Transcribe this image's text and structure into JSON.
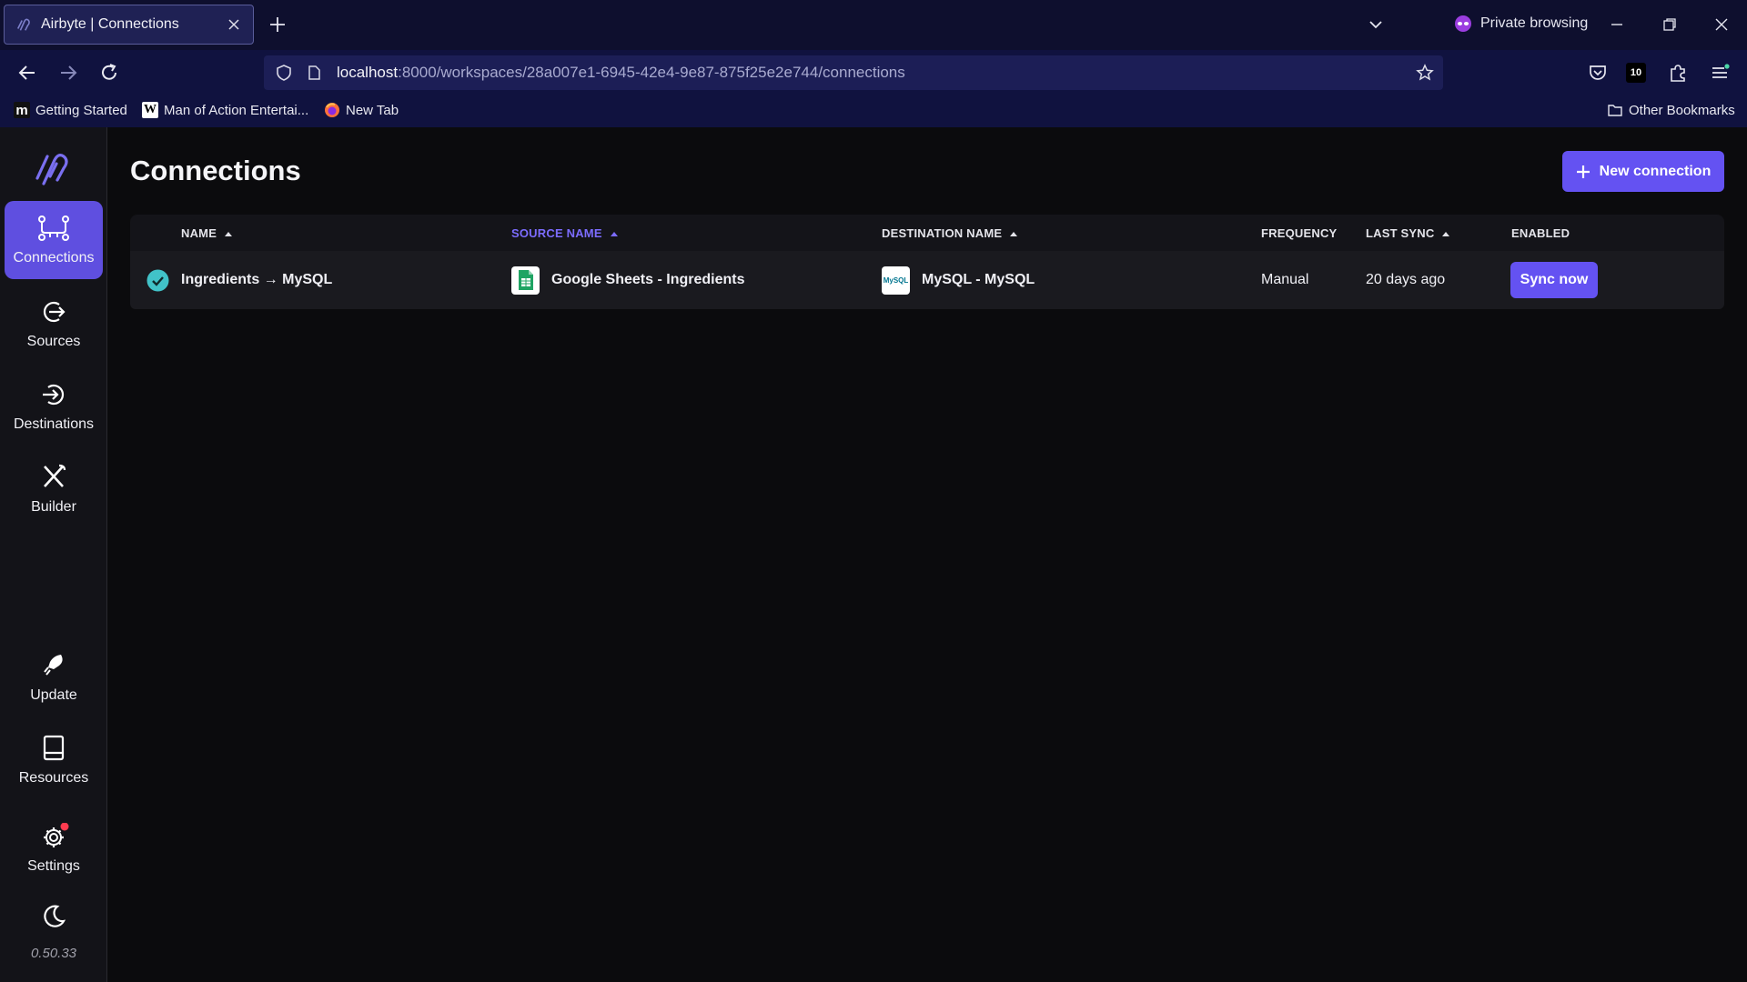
{
  "browser": {
    "tab_title": "Airbyte | Connections",
    "private_label": "Private browsing",
    "url_host": "localhost",
    "url_path": ":8000/workspaces/28a007e1-6945-42e4-9e87-875f25e2e744/connections",
    "extension_badge": "10",
    "bookmarks": [
      {
        "label": "Getting Started",
        "icon": "m-logo-icon"
      },
      {
        "label": "Man of Action Entertai...",
        "icon": "wikipedia-icon"
      },
      {
        "label": "New Tab",
        "icon": "firefox-icon"
      }
    ],
    "other_bookmarks": "Other Bookmarks"
  },
  "sidebar": {
    "items": [
      {
        "label": "Connections",
        "icon": "connections-icon",
        "active": true
      },
      {
        "label": "Sources",
        "icon": "sources-icon"
      },
      {
        "label": "Destinations",
        "icon": "destinations-icon"
      },
      {
        "label": "Builder",
        "icon": "builder-icon"
      }
    ],
    "bottom_items": [
      {
        "label": "Update",
        "icon": "rocket-icon"
      },
      {
        "label": "Resources",
        "icon": "book-icon"
      },
      {
        "label": "Settings",
        "icon": "gear-icon"
      }
    ],
    "version": "0.50.33"
  },
  "main": {
    "title": "Connections",
    "new_button": "New connection",
    "columns": {
      "name": "NAME",
      "source": "SOURCE NAME",
      "destination": "DESTINATION NAME",
      "frequency": "FREQUENCY",
      "last_sync": "LAST SYNC",
      "enabled": "ENABLED"
    },
    "rows": [
      {
        "name": "Ingredients → MySQL",
        "source": "Google Sheets - Ingredients",
        "destination": "MySQL - MySQL",
        "destination_logo_text": "MySQL",
        "frequency": "Manual",
        "last_sync": "20 days ago",
        "action": "Sync now"
      }
    ]
  },
  "colors": {
    "accent": "#6452f2",
    "sorted_header": "#7c6cff",
    "status_ok": "#41c2c8",
    "notification": "#ff3b4f"
  }
}
